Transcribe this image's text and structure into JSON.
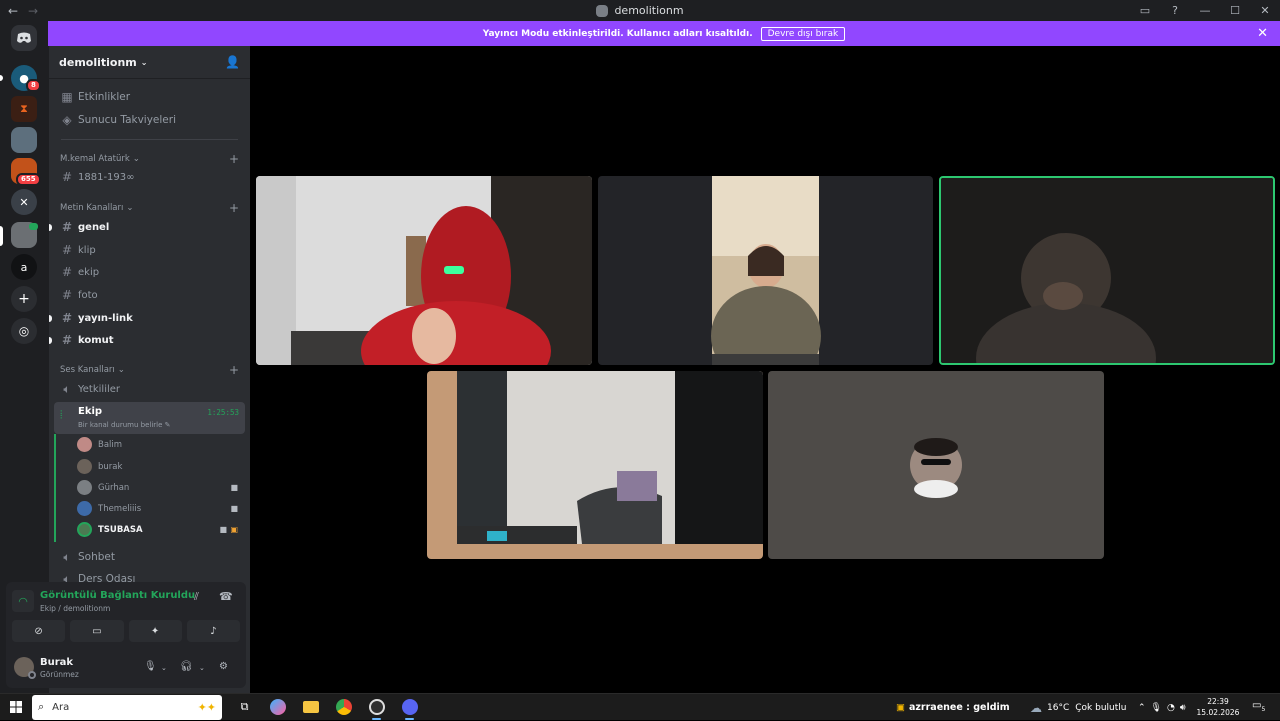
{
  "window": {
    "title": "demolitionm"
  },
  "banner": {
    "text": "Yayıncı Modu etkinleştirildi. Kullanıcı adları kısaltıldı.",
    "button": "Devre dışı bırak"
  },
  "guilds": {
    "badge1": "8",
    "badge2": "655",
    "letter": "a"
  },
  "server": {
    "name": "demolitionm",
    "events": "Etkinlikler",
    "boosts": "Sunucu Takviyeleri",
    "cat1": "M.kemal Atatürk",
    "ch1": "1881-193∞",
    "cat2": "Metin Kanalları",
    "text_channels": [
      "genel",
      "klip",
      "ekip",
      "foto",
      "yayın-link",
      "komut"
    ],
    "cat3": "Ses Kanalları",
    "voice_auth": "Yetkililer",
    "active_voice": {
      "name": "Ekip",
      "status": "Bir kanal durumu belirle",
      "timer": "1:25:53"
    },
    "voice_users": [
      "Balim",
      "burak",
      "Gürhan",
      "Themeliiis",
      "TSUBASA"
    ],
    "voice_more": [
      "Sohbet",
      "Ders Odası"
    ]
  },
  "rtc": {
    "title": "Görüntülü Bağlantı Kuruldu",
    "subtitle": "Ekip / demolitionm"
  },
  "user": {
    "name": "Burak",
    "status": "Görünmez"
  },
  "taskbar": {
    "search_placeholder": "Ara",
    "notification": "azrraenee : geldim",
    "temperature": "16°C",
    "weather": "Çok bulutlu",
    "time": "22:39",
    "date": "15.02.2026",
    "bell_count": "5"
  },
  "colors": {
    "accent": "#9147ff",
    "connected": "#23a55a",
    "speaking_border": "#2dc770"
  }
}
